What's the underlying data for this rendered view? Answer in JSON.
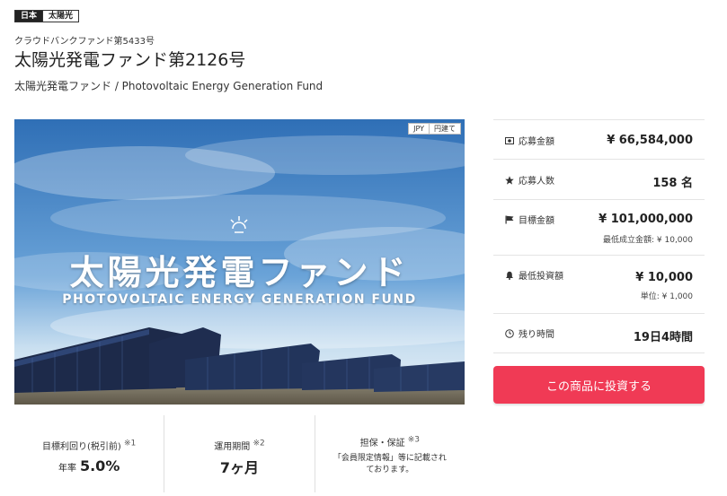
{
  "tags": [
    "日本",
    "太陽光"
  ],
  "fund_number_label": "クラウドバンクファンド第5433号",
  "title": "太陽光発電ファンド第2126号",
  "description": "太陽光発電ファンド / Photovoltaic Energy Generation Fund",
  "hero": {
    "title": "太陽光発電ファンド",
    "subtitle": "PHOTOVOLTAIC ENERGY GENERATION FUND",
    "badges": [
      "JPY",
      "円建て"
    ]
  },
  "stats": [
    {
      "icon": "money-icon",
      "label": "応募金額",
      "value": "¥ 66,584,000"
    },
    {
      "icon": "star-icon",
      "label": "応募人数",
      "value": "158 名"
    },
    {
      "icon": "flag-icon",
      "label": "目標金額",
      "value": "¥ 101,000,000",
      "note": "最低成立金額: ¥ 10,000"
    },
    {
      "icon": "bell-icon",
      "label": "最低投資額",
      "value": "¥ 10,000",
      "note": "単位: ¥ 1,000"
    },
    {
      "icon": "clock-icon",
      "label": "残り時間",
      "value": "19日4時間"
    }
  ],
  "invest_button": "この商品に投資する",
  "features": [
    {
      "label": "目標利回り(税引前)",
      "mark": "※1",
      "prefix": "年率",
      "value": "5.0%"
    },
    {
      "label": "運用期間",
      "mark": "※2",
      "value": "7ヶ月"
    },
    {
      "label": "担保・保証",
      "mark": "※3",
      "note_lines": [
        "「会員限定情報」等に記載され",
        "ております。"
      ]
    }
  ]
}
